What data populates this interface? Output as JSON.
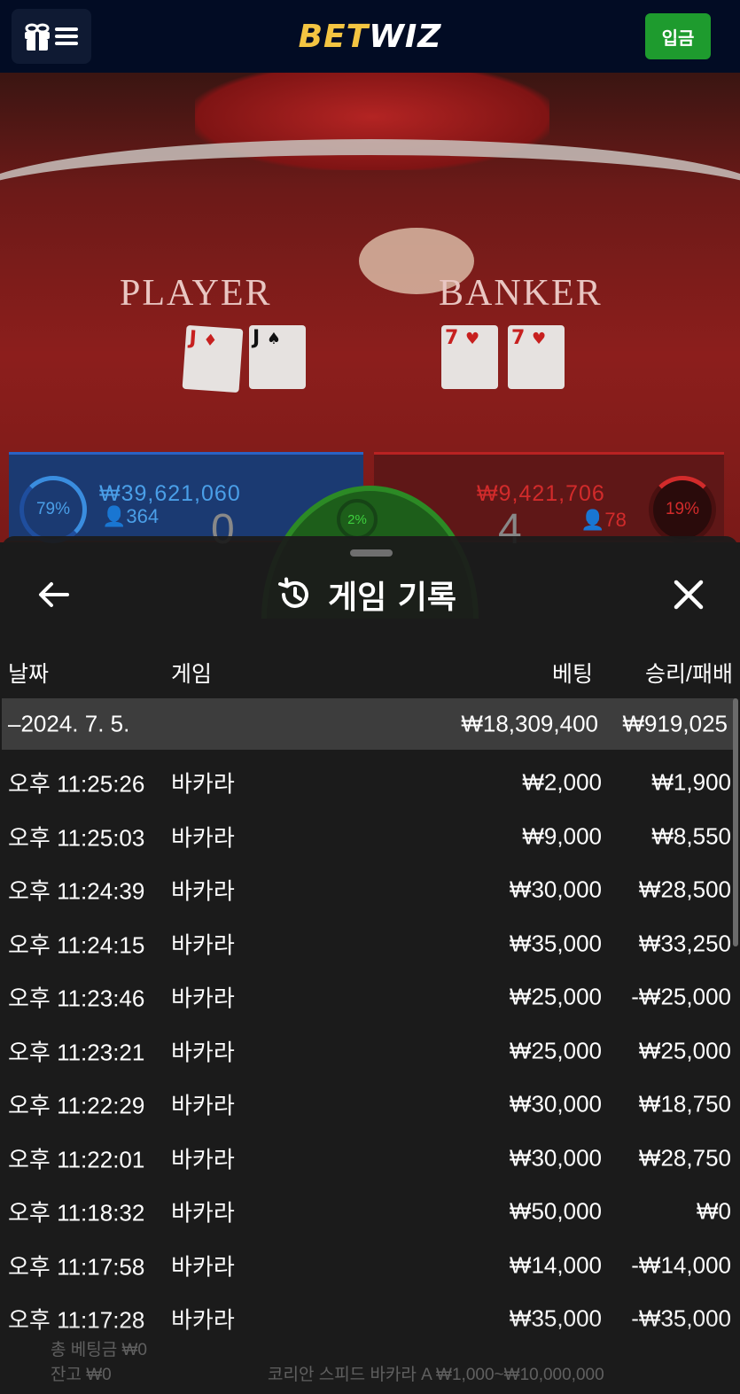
{
  "header": {
    "logo_part1": "BET",
    "logo_part2": "WIZ",
    "deposit_label": "입금",
    "menu_icons": [
      "gift-icon",
      "menu-icon"
    ]
  },
  "video": {
    "player_label": "PLAYER",
    "banker_label": "BANKER",
    "player_cards": [
      {
        "rank": "J",
        "suit": "♦"
      },
      {
        "rank": "J",
        "suit": "♠"
      }
    ],
    "banker_cards": [
      {
        "rank": "7",
        "suit": "♥"
      },
      {
        "rank": "7",
        "suit": "♥"
      }
    ]
  },
  "stats": {
    "player_pct": "79%",
    "player_amount": "₩39,621,060",
    "player_count": "364",
    "player_score": "0",
    "tie_pct": "2%",
    "banker_pct": "19%",
    "banker_amount": "₩9,421,706",
    "banker_count": "78",
    "banker_score": "4"
  },
  "panel": {
    "title": "게임 기록",
    "columns": {
      "date": "날짜",
      "game": "게임",
      "bet": "베팅",
      "result": "승리/패배"
    },
    "day_summary": {
      "date": "–2024. 7. 5.",
      "bet": "₩18,309,400",
      "result": "₩919,025"
    },
    "rows": [
      {
        "time": "오후 11:25:26",
        "game": "바카라",
        "bet": "₩2,000",
        "result": "₩1,900"
      },
      {
        "time": "오후 11:25:03",
        "game": "바카라",
        "bet": "₩9,000",
        "result": "₩8,550"
      },
      {
        "time": "오후 11:24:39",
        "game": "바카라",
        "bet": "₩30,000",
        "result": "₩28,500"
      },
      {
        "time": "오후 11:24:15",
        "game": "바카라",
        "bet": "₩35,000",
        "result": "₩33,250"
      },
      {
        "time": "오후 11:23:46",
        "game": "바카라",
        "bet": "₩25,000",
        "result": "-₩25,000"
      },
      {
        "time": "오후 11:23:21",
        "game": "바카라",
        "bet": "₩25,000",
        "result": "₩25,000"
      },
      {
        "time": "오후 11:22:29",
        "game": "바카라",
        "bet": "₩30,000",
        "result": "₩18,750"
      },
      {
        "time": "오후 11:22:01",
        "game": "바카라",
        "bet": "₩30,000",
        "result": "₩28,750"
      },
      {
        "time": "오후 11:18:32",
        "game": "바카라",
        "bet": "₩50,000",
        "result": "₩0"
      },
      {
        "time": "오후 11:17:58",
        "game": "바카라",
        "bet": "₩14,000",
        "result": "-₩14,000"
      },
      {
        "time": "오후 11:17:28",
        "game": "바카라",
        "bet": "₩35,000",
        "result": "-₩35,000"
      }
    ]
  },
  "footer": {
    "total_bet": "총 베팅금 ₩0",
    "balance": "잔고 ₩0",
    "table_name": "코리안 스피드 바카라 A ₩1,000~₩10,000,000"
  }
}
